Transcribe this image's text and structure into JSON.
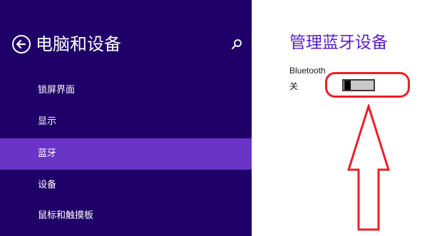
{
  "sidebar": {
    "title": "电脑和设备",
    "items": [
      {
        "label": "锁屏界面",
        "active": false
      },
      {
        "label": "显示",
        "active": false
      },
      {
        "label": "蓝牙",
        "active": true
      },
      {
        "label": "设备",
        "active": false
      },
      {
        "label": "鼠标和触摸板",
        "active": false
      }
    ]
  },
  "content": {
    "title": "管理蓝牙设备",
    "bluetooth_label": "Bluetooth",
    "bluetooth_state": "关"
  },
  "icons": {
    "back": "back-arrow-circle-icon",
    "search": "search-icon"
  },
  "colors": {
    "sidebar_bg": "#1f0068",
    "active_item": "#6a34c7",
    "accent": "#5a1fc8",
    "annotation": "#e8202a"
  }
}
